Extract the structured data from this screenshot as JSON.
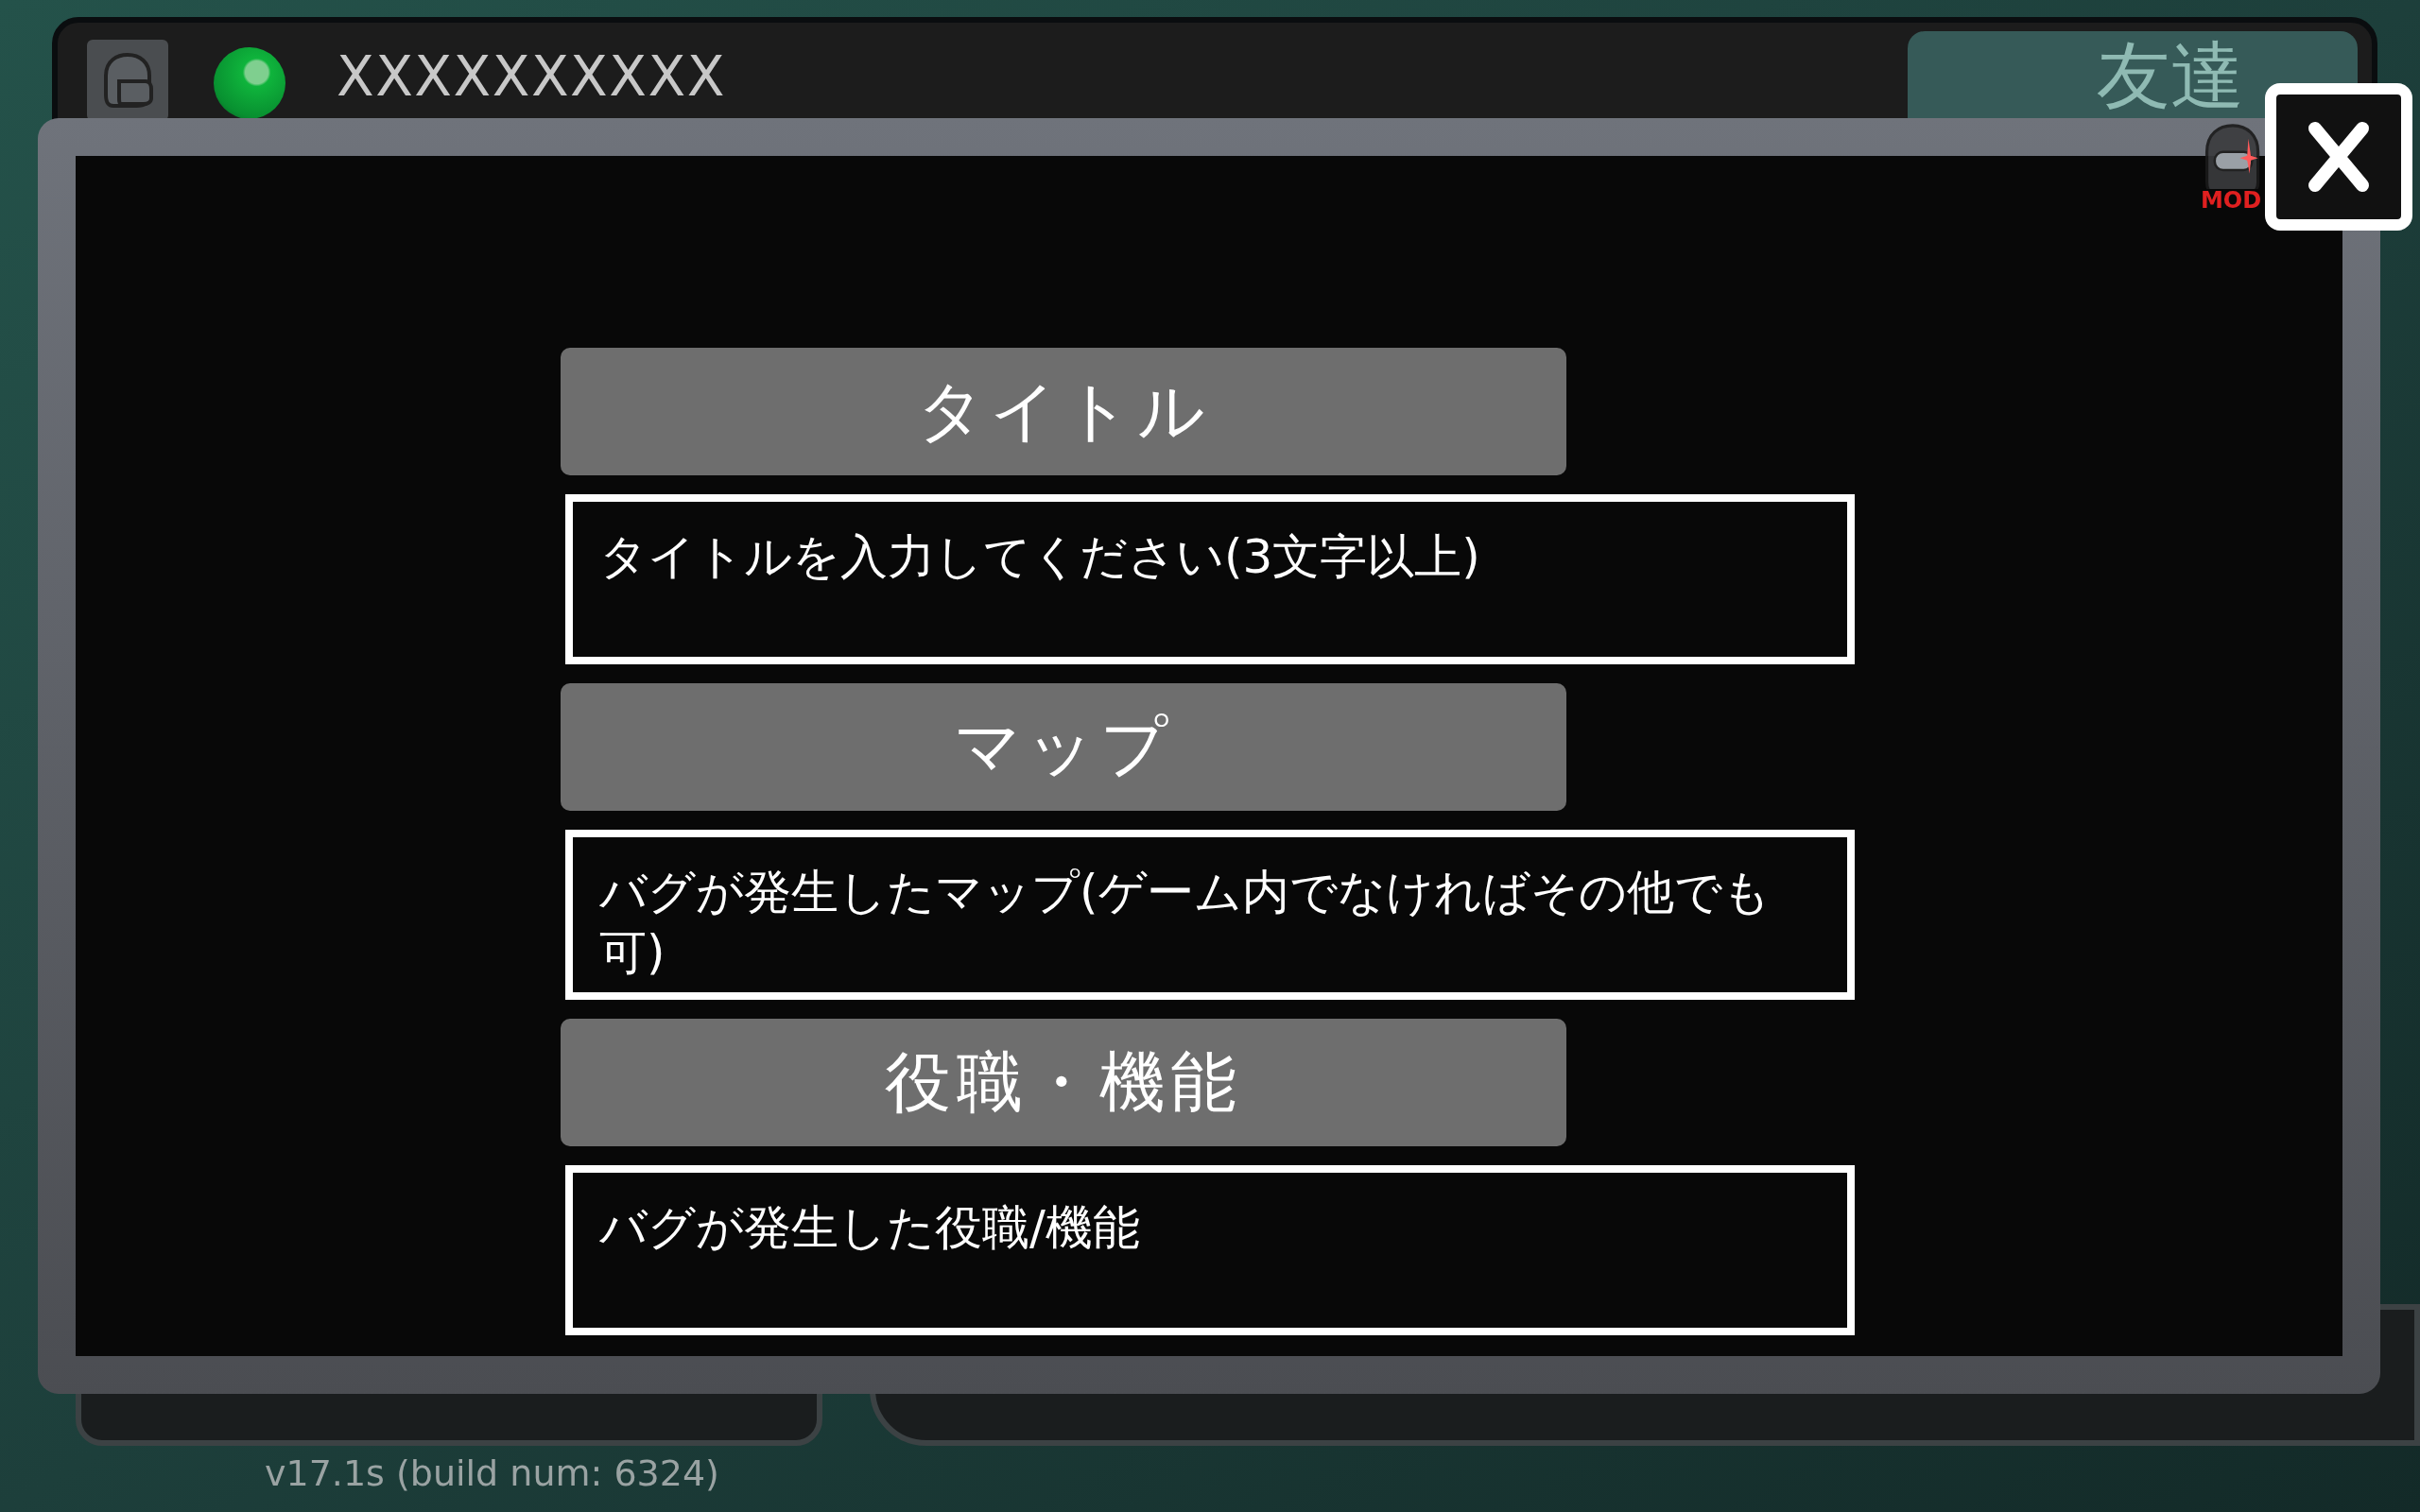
{
  "top_bar": {
    "player_name": "XXXXXXXXXX",
    "friends_tab": "友達",
    "mod_badge": "MOD"
  },
  "dialog": {
    "sections": [
      {
        "header": "タイトル",
        "field": {
          "placeholder": "タイトルを入力してください(3文字以上)"
        }
      },
      {
        "header": "マップ",
        "field": {
          "placeholder": "バグが発生したマップ(ゲーム内でなければその他でも可)"
        }
      },
      {
        "header": "役職・機能",
        "field": {
          "placeholder": "バグが発生した役職/機能"
        }
      }
    ]
  },
  "version": "v17.1s (build num: 6324)"
}
